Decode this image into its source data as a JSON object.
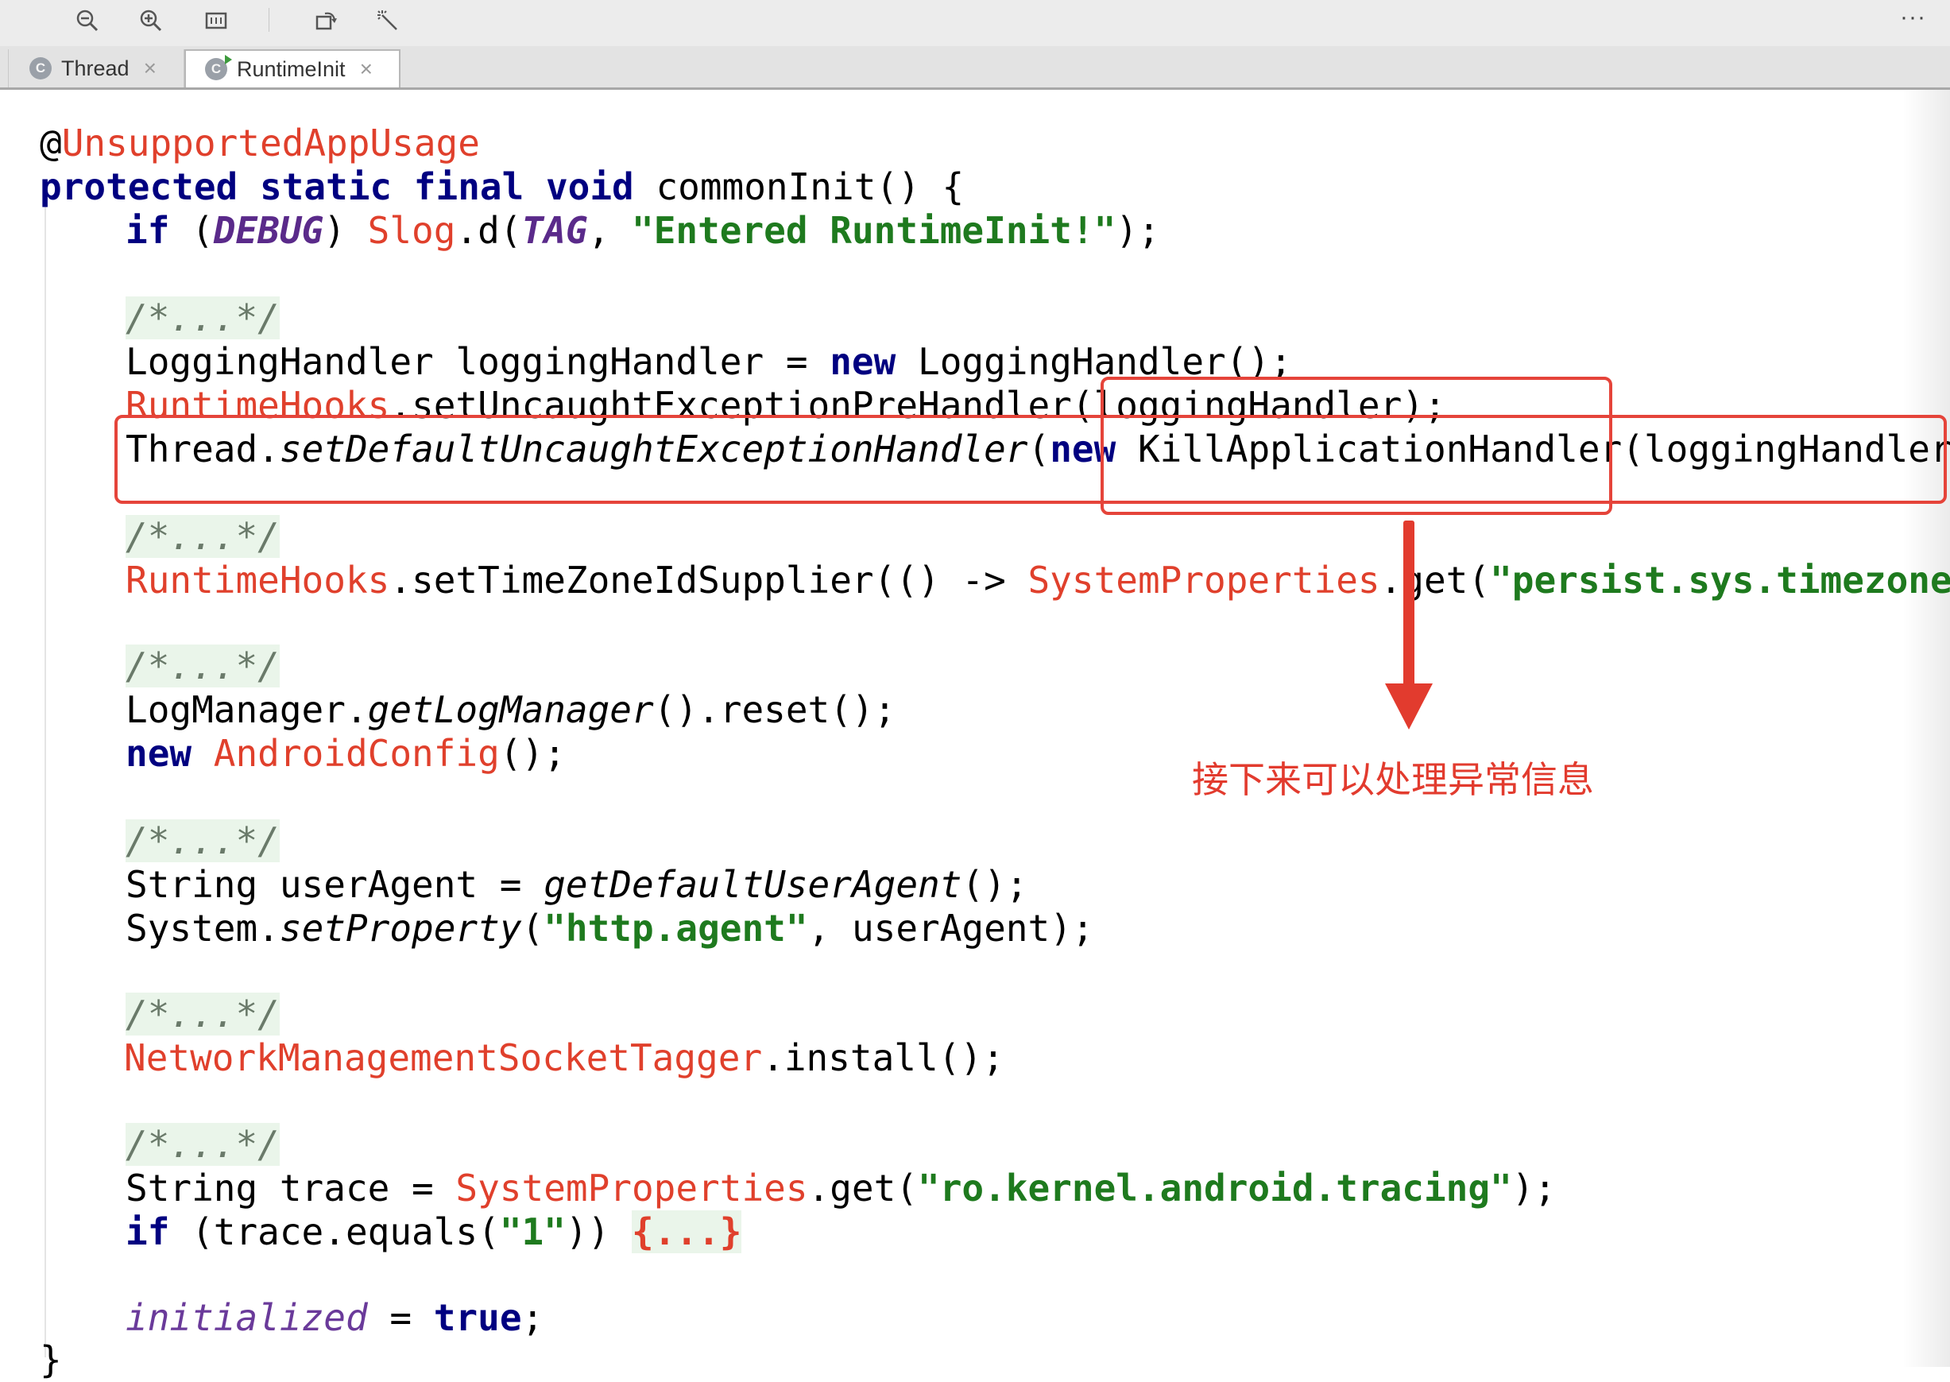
{
  "toolbar": {
    "icons": [
      "zoom-out-icon",
      "zoom-in-icon",
      "fit-width-icon",
      "rotate-icon",
      "markup-icon"
    ],
    "more_label": "···"
  },
  "tabs": [
    {
      "label": "Thread",
      "icon_letter": "C",
      "active": false
    },
    {
      "label": "RuntimeInit",
      "icon_letter": "C",
      "active": true
    }
  ],
  "tab_close_glyph": "×",
  "code": {
    "annotation_at": "@",
    "annotation_name": "UnsupportedAppUsage",
    "sig_kw": "protected static final void",
    "sig_rest": " commonInit() {",
    "l3_kw": "if",
    "l3_open": " (",
    "l3_debug": "DEBUG",
    "l3_close": ") ",
    "l3_slog": "Slog",
    "l3_d": ".d(",
    "l3_tag": "TAG",
    "l3_comma": ", ",
    "l3_str": "\"Entered RuntimeInit!\"",
    "l3_end": ");",
    "comment": "/*...*/",
    "l5_a": "LoggingHandler loggingHandler = ",
    "l5_new": "new",
    "l5_b": " LoggingHandler();",
    "l6_cls": "RuntimeHooks",
    "l6_rest": ".setUncaughtExceptionPreHandler(loggingHandler);",
    "l7_a": "Thread.",
    "l7_method": "setDefaultUncaughtExceptionHandler",
    "l7_paren": "(",
    "l7_new": "new",
    "l7_b": " KillApplicationHandler(loggingHandler)",
    "l9_cls": "RuntimeHooks",
    "l9_a": ".setTimeZoneIdSupplier(() -> ",
    "l9_cls2": "SystemProperties",
    "l9_b": ".get(",
    "l9_str": "\"persist.sys.timezone\"",
    "l11_a": "LogManager.",
    "l11_method": "getLogManager",
    "l11_b": "().reset();",
    "l12_new": "new",
    "l12_sp": " ",
    "l12_cls": "AndroidConfig",
    "l12_b": "();",
    "l14_a": "String userAgent = ",
    "l14_method": "getDefaultUserAgent",
    "l14_b": "();",
    "l15_a": "System.",
    "l15_method": "setProperty",
    "l15_paren": "(",
    "l15_str": "\"http.agent\"",
    "l15_b": ", userAgent);",
    "l17_cls": "NetworkManagementSocketTagger",
    "l17_b": ".install();",
    "l19_a": "String trace = ",
    "l19_cls": "SystemProperties",
    "l19_b": ".get(",
    "l19_str": "\"ro.kernel.android.tracing\"",
    "l19_end": ");",
    "l20_kw": "if",
    "l20_a": " (trace.equals(",
    "l20_str": "\"1\"",
    "l20_b": ")) ",
    "l20_fold": "{...}",
    "l22_field": "initialized",
    "l22_a": " = ",
    "l22_true": "true",
    "l22_end": ";",
    "closing_brace": "}"
  },
  "annotation_note": "接下来可以处理异常信息",
  "colors": {
    "keyword": "#000080",
    "class_ref": "#e0402c",
    "string": "#1e7a1e",
    "static_field": "#5a2a8a",
    "highlight_box": "#e5443a",
    "note": "#e23b2e"
  }
}
